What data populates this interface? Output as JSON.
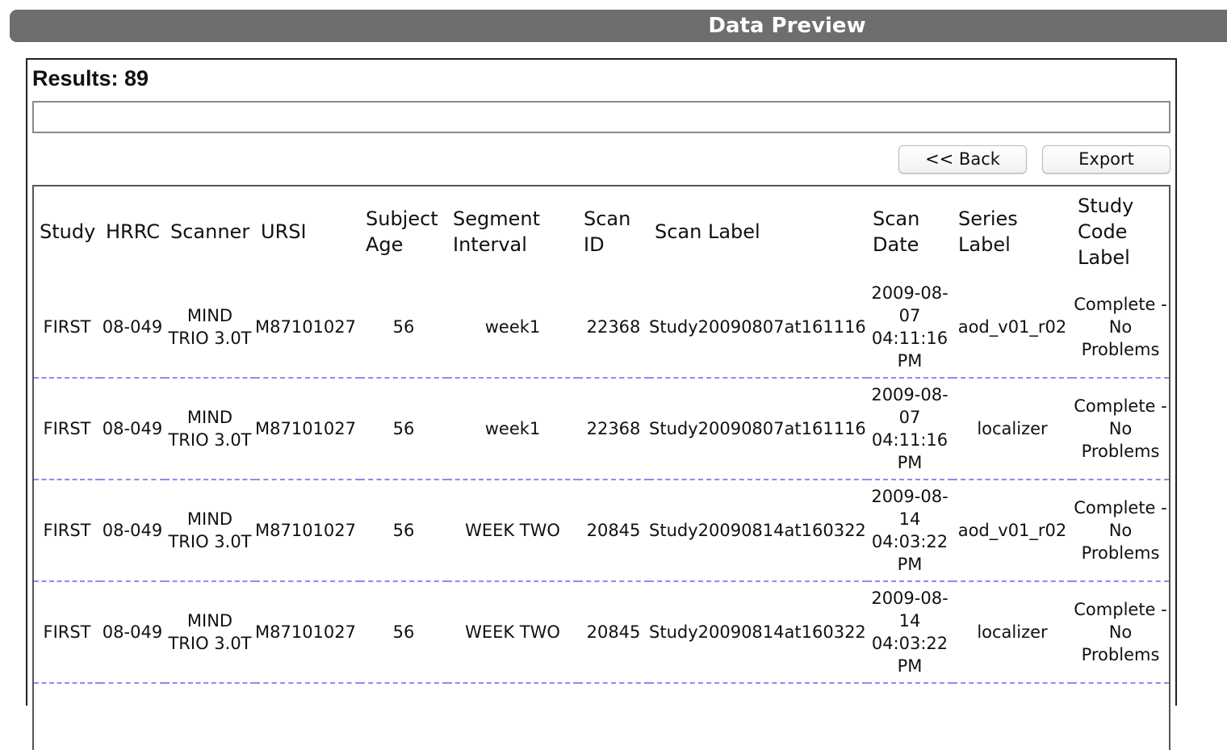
{
  "header": {
    "title": "Data Preview"
  },
  "results": {
    "label": "Results: 89"
  },
  "filter": {
    "value": ""
  },
  "buttons": {
    "back": "<<  Back",
    "export": "Export"
  },
  "table": {
    "columns": [
      "Study",
      "HRRC",
      "Scanner",
      "URSI",
      "Subject Age",
      "Segment Interval",
      "Scan ID",
      "Scan Label",
      "Scan Date",
      "Series Label",
      "Study Code Label"
    ],
    "rows": [
      {
        "study": "FIRST",
        "hrrc": "08-049",
        "scanner": "MIND TRIO 3.0T",
        "ursi": "M87101027",
        "age": "56",
        "interval": "week1",
        "scan_id": "22368",
        "scan_label": "Study20090807at161116",
        "scan_date": "2009-08-07 04:11:16 PM",
        "series_label": "aod_v01_r02",
        "study_code": "Complete - No Problems"
      },
      {
        "study": "FIRST",
        "hrrc": "08-049",
        "scanner": "MIND TRIO 3.0T",
        "ursi": "M87101027",
        "age": "56",
        "interval": "week1",
        "scan_id": "22368",
        "scan_label": "Study20090807at161116",
        "scan_date": "2009-08-07 04:11:16 PM",
        "series_label": "localizer",
        "study_code": "Complete - No Problems"
      },
      {
        "study": "FIRST",
        "hrrc": "08-049",
        "scanner": "MIND TRIO 3.0T",
        "ursi": "M87101027",
        "age": "56",
        "interval": "WEEK TWO",
        "scan_id": "20845",
        "scan_label": "Study20090814at160322",
        "scan_date": "2009-08-14 04:03:22 PM",
        "series_label": "aod_v01_r02",
        "study_code": "Complete - No Problems"
      },
      {
        "study": "FIRST",
        "hrrc": "08-049",
        "scanner": "MIND TRIO 3.0T",
        "ursi": "M87101027",
        "age": "56",
        "interval": "WEEK TWO",
        "scan_id": "20845",
        "scan_label": "Study20090814at160322",
        "scan_date": "2009-08-14 04:03:22 PM",
        "series_label": "localizer",
        "study_code": "Complete - No Problems"
      }
    ]
  }
}
